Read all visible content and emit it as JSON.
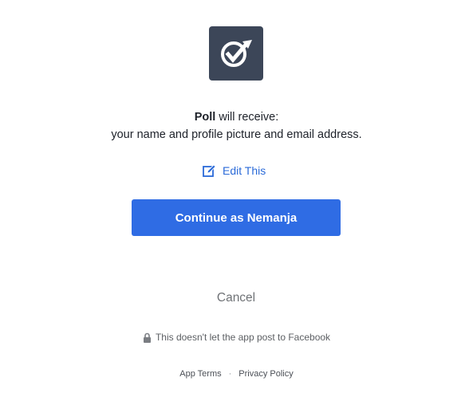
{
  "app": {
    "name": "Poll",
    "logo_icon": "poll-checkmark-icon",
    "logo_bg": "#3c4658"
  },
  "permissions": {
    "receive_suffix": " will receive:",
    "scope_text": "your name and profile picture and email address."
  },
  "edit": {
    "icon": "edit-icon",
    "label": "Edit This"
  },
  "continue_button": {
    "label": "Continue as Nemanja",
    "color": "#2f6ce4"
  },
  "cancel": {
    "label": "Cancel"
  },
  "privacy_note": {
    "icon": "lock-icon",
    "text": "This doesn't let the app post to Facebook"
  },
  "footer": {
    "app_terms": "App Terms",
    "separator": "·",
    "privacy_policy": "Privacy Policy"
  }
}
